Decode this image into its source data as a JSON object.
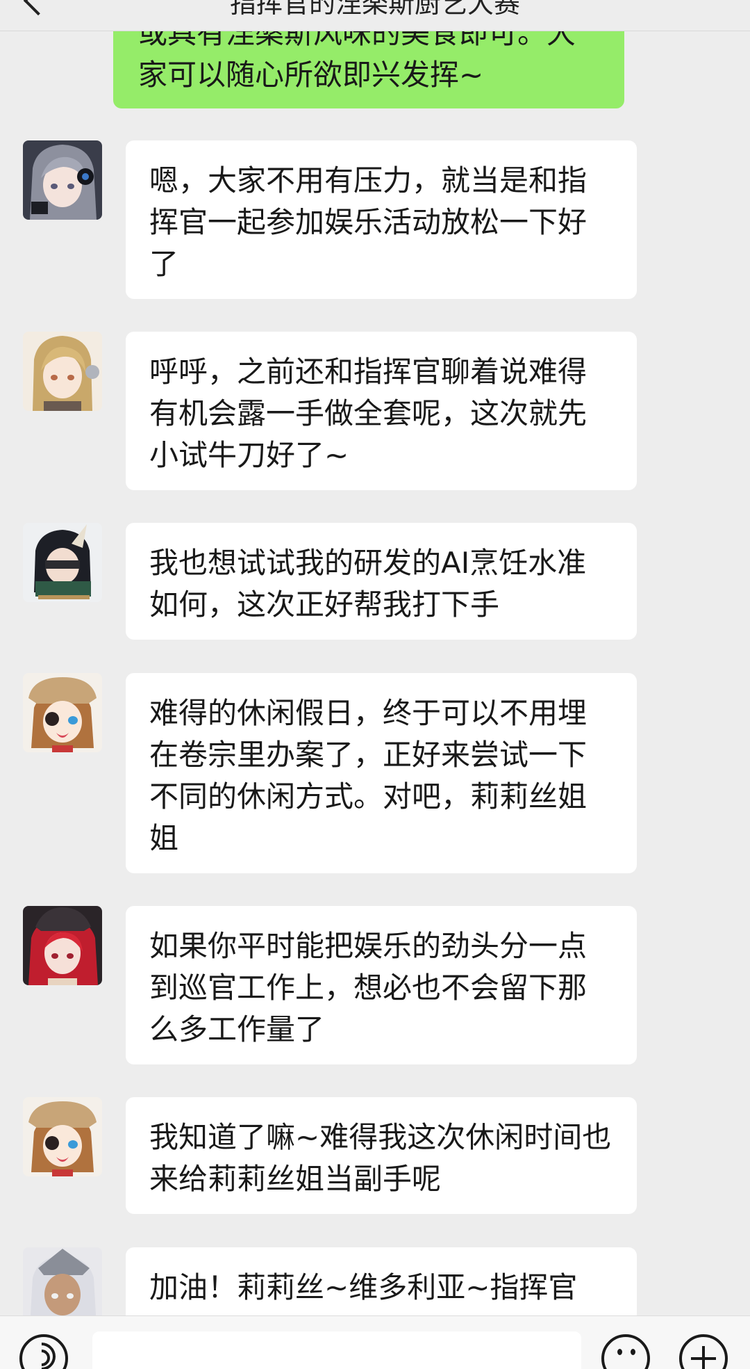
{
  "header": {
    "title": "指挥官的涅楽斯厨艺大赛"
  },
  "my_message": {
    "text": "或具有涅槃斯风味的美食即可。大家可以随心所欲即兴发挥~"
  },
  "messages": [
    {
      "text": "嗯，大家不用有压力，就当是和指挥官一起参加娱乐活动放松一下好了"
    },
    {
      "text": "呼呼，之前还和指挥官聊着说难得有机会露一手做全套呢，这次就先小试牛刀好了~"
    },
    {
      "text": "我也想试试我的研发的AI烹饪水准如何，这次正好帮我打下手"
    },
    {
      "text": "难得的休闲假日，终于可以不用埋在卷宗里办案了，正好来尝试一下不同的休闲方式。对吧，莉莉丝姐姐"
    },
    {
      "text": "如果你平时能把娱乐的劲头分一点到巡官工作上，想必也不会留下那么多工作量了"
    },
    {
      "text": "我知道了嘛~难得我这次休闲时间也来给莉莉丝姐当副手呢"
    },
    {
      "text": "加油！莉莉丝~维多利亚~指挥官"
    }
  ]
}
